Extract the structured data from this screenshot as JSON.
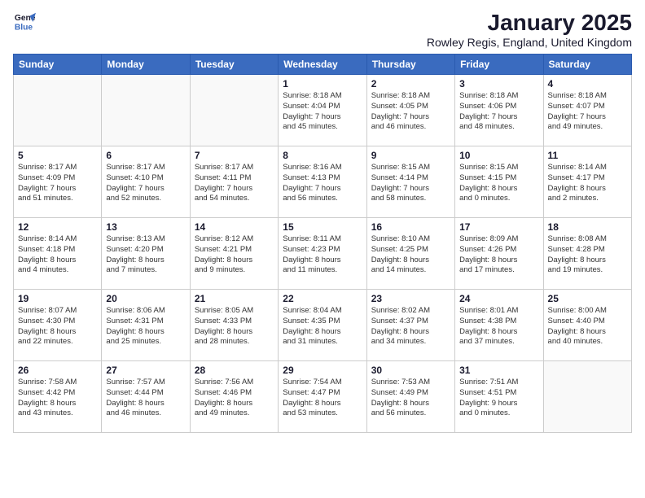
{
  "logo": {
    "line1": "General",
    "line2": "Blue"
  },
  "title": "January 2025",
  "subtitle": "Rowley Regis, England, United Kingdom",
  "headers": [
    "Sunday",
    "Monday",
    "Tuesday",
    "Wednesday",
    "Thursday",
    "Friday",
    "Saturday"
  ],
  "weeks": [
    [
      {
        "day": "",
        "info": "",
        "empty": true
      },
      {
        "day": "",
        "info": "",
        "empty": true
      },
      {
        "day": "",
        "info": "",
        "empty": true
      },
      {
        "day": "1",
        "info": "Sunrise: 8:18 AM\nSunset: 4:04 PM\nDaylight: 7 hours\nand 45 minutes.",
        "empty": false
      },
      {
        "day": "2",
        "info": "Sunrise: 8:18 AM\nSunset: 4:05 PM\nDaylight: 7 hours\nand 46 minutes.",
        "empty": false
      },
      {
        "day": "3",
        "info": "Sunrise: 8:18 AM\nSunset: 4:06 PM\nDaylight: 7 hours\nand 48 minutes.",
        "empty": false
      },
      {
        "day": "4",
        "info": "Sunrise: 8:18 AM\nSunset: 4:07 PM\nDaylight: 7 hours\nand 49 minutes.",
        "empty": false
      }
    ],
    [
      {
        "day": "5",
        "info": "Sunrise: 8:17 AM\nSunset: 4:09 PM\nDaylight: 7 hours\nand 51 minutes.",
        "empty": false
      },
      {
        "day": "6",
        "info": "Sunrise: 8:17 AM\nSunset: 4:10 PM\nDaylight: 7 hours\nand 52 minutes.",
        "empty": false
      },
      {
        "day": "7",
        "info": "Sunrise: 8:17 AM\nSunset: 4:11 PM\nDaylight: 7 hours\nand 54 minutes.",
        "empty": false
      },
      {
        "day": "8",
        "info": "Sunrise: 8:16 AM\nSunset: 4:13 PM\nDaylight: 7 hours\nand 56 minutes.",
        "empty": false
      },
      {
        "day": "9",
        "info": "Sunrise: 8:15 AM\nSunset: 4:14 PM\nDaylight: 7 hours\nand 58 minutes.",
        "empty": false
      },
      {
        "day": "10",
        "info": "Sunrise: 8:15 AM\nSunset: 4:15 PM\nDaylight: 8 hours\nand 0 minutes.",
        "empty": false
      },
      {
        "day": "11",
        "info": "Sunrise: 8:14 AM\nSunset: 4:17 PM\nDaylight: 8 hours\nand 2 minutes.",
        "empty": false
      }
    ],
    [
      {
        "day": "12",
        "info": "Sunrise: 8:14 AM\nSunset: 4:18 PM\nDaylight: 8 hours\nand 4 minutes.",
        "empty": false
      },
      {
        "day": "13",
        "info": "Sunrise: 8:13 AM\nSunset: 4:20 PM\nDaylight: 8 hours\nand 7 minutes.",
        "empty": false
      },
      {
        "day": "14",
        "info": "Sunrise: 8:12 AM\nSunset: 4:21 PM\nDaylight: 8 hours\nand 9 minutes.",
        "empty": false
      },
      {
        "day": "15",
        "info": "Sunrise: 8:11 AM\nSunset: 4:23 PM\nDaylight: 8 hours\nand 11 minutes.",
        "empty": false
      },
      {
        "day": "16",
        "info": "Sunrise: 8:10 AM\nSunset: 4:25 PM\nDaylight: 8 hours\nand 14 minutes.",
        "empty": false
      },
      {
        "day": "17",
        "info": "Sunrise: 8:09 AM\nSunset: 4:26 PM\nDaylight: 8 hours\nand 17 minutes.",
        "empty": false
      },
      {
        "day": "18",
        "info": "Sunrise: 8:08 AM\nSunset: 4:28 PM\nDaylight: 8 hours\nand 19 minutes.",
        "empty": false
      }
    ],
    [
      {
        "day": "19",
        "info": "Sunrise: 8:07 AM\nSunset: 4:30 PM\nDaylight: 8 hours\nand 22 minutes.",
        "empty": false
      },
      {
        "day": "20",
        "info": "Sunrise: 8:06 AM\nSunset: 4:31 PM\nDaylight: 8 hours\nand 25 minutes.",
        "empty": false
      },
      {
        "day": "21",
        "info": "Sunrise: 8:05 AM\nSunset: 4:33 PM\nDaylight: 8 hours\nand 28 minutes.",
        "empty": false
      },
      {
        "day": "22",
        "info": "Sunrise: 8:04 AM\nSunset: 4:35 PM\nDaylight: 8 hours\nand 31 minutes.",
        "empty": false
      },
      {
        "day": "23",
        "info": "Sunrise: 8:02 AM\nSunset: 4:37 PM\nDaylight: 8 hours\nand 34 minutes.",
        "empty": false
      },
      {
        "day": "24",
        "info": "Sunrise: 8:01 AM\nSunset: 4:38 PM\nDaylight: 8 hours\nand 37 minutes.",
        "empty": false
      },
      {
        "day": "25",
        "info": "Sunrise: 8:00 AM\nSunset: 4:40 PM\nDaylight: 8 hours\nand 40 minutes.",
        "empty": false
      }
    ],
    [
      {
        "day": "26",
        "info": "Sunrise: 7:58 AM\nSunset: 4:42 PM\nDaylight: 8 hours\nand 43 minutes.",
        "empty": false
      },
      {
        "day": "27",
        "info": "Sunrise: 7:57 AM\nSunset: 4:44 PM\nDaylight: 8 hours\nand 46 minutes.",
        "empty": false
      },
      {
        "day": "28",
        "info": "Sunrise: 7:56 AM\nSunset: 4:46 PM\nDaylight: 8 hours\nand 49 minutes.",
        "empty": false
      },
      {
        "day": "29",
        "info": "Sunrise: 7:54 AM\nSunset: 4:47 PM\nDaylight: 8 hours\nand 53 minutes.",
        "empty": false
      },
      {
        "day": "30",
        "info": "Sunrise: 7:53 AM\nSunset: 4:49 PM\nDaylight: 8 hours\nand 56 minutes.",
        "empty": false
      },
      {
        "day": "31",
        "info": "Sunrise: 7:51 AM\nSunset: 4:51 PM\nDaylight: 9 hours\nand 0 minutes.",
        "empty": false
      },
      {
        "day": "",
        "info": "",
        "empty": true
      }
    ]
  ]
}
